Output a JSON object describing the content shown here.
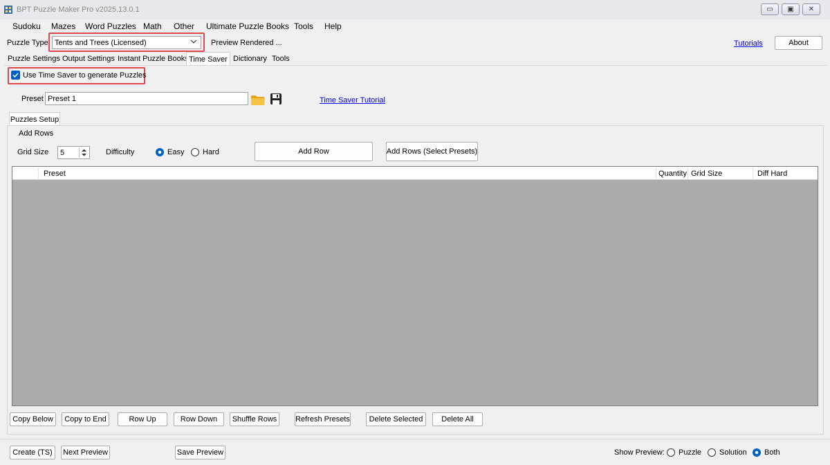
{
  "window": {
    "title": "BPT Puzzle Maker Pro v2025.13.0.1",
    "minimize_glyph": "▭",
    "restore_glyph": "▣",
    "close_glyph": "✕"
  },
  "menu": [
    "Sudoku",
    "Mazes",
    "Word Puzzles",
    "Math",
    "Other",
    "Ultimate Puzzle Books",
    "Tools",
    "Help"
  ],
  "toolbar": {
    "puzzle_type_label": "Puzzle Type",
    "puzzle_type_value": "Tents and Trees (Licensed)",
    "preview_status": "Preview Rendered ...",
    "tutorials_link": "Tutorials",
    "about_button": "About"
  },
  "tabs": [
    "Puzzle Settings",
    "Output Settings",
    "Instant Puzzle Books",
    "Time Saver",
    "Dictionary",
    "Tools"
  ],
  "active_tab": "Time Saver",
  "time_saver": {
    "use_checkbox_label": "Use Time Saver to generate Puzzles",
    "use_checked": true,
    "preset_label": "Preset",
    "preset_value": "Preset 1",
    "tutorial_link": "Time Saver Tutorial"
  },
  "puzzles_setup": {
    "tab_label": "Puzzles Setup",
    "group_label": "Add Rows",
    "grid_size_label": "Grid Size",
    "grid_size_value": "5",
    "difficulty_label": "Difficulty",
    "difficulty_easy": "Easy",
    "difficulty_hard": "Hard",
    "difficulty_selected": "Easy",
    "add_row_button": "Add Row",
    "add_rows_presets_button": "Add Rows (Select Presets)"
  },
  "grid": {
    "columns": [
      "Preset",
      "Quantity",
      "Grid Size",
      "Diff Hard"
    ],
    "rows": []
  },
  "row_actions": [
    "Copy Below",
    "Copy to End",
    "Row Up",
    "Row Down",
    "Shuffle Rows",
    "Refresh Presets",
    "Delete Selected",
    "Delete All"
  ],
  "bottom": {
    "create_button": "Create (TS)",
    "next_preview_button": "Next Preview",
    "save_preview_button": "Save Preview",
    "show_preview_label": "Show Preview:",
    "preview_options": [
      "Puzzle",
      "Solution",
      "Both"
    ],
    "preview_selected": "Both"
  },
  "colors": {
    "highlight_box": "#e0474c",
    "accent_blue": "#0060c0",
    "grid_background": "#ababab",
    "link": "#0000ee"
  }
}
